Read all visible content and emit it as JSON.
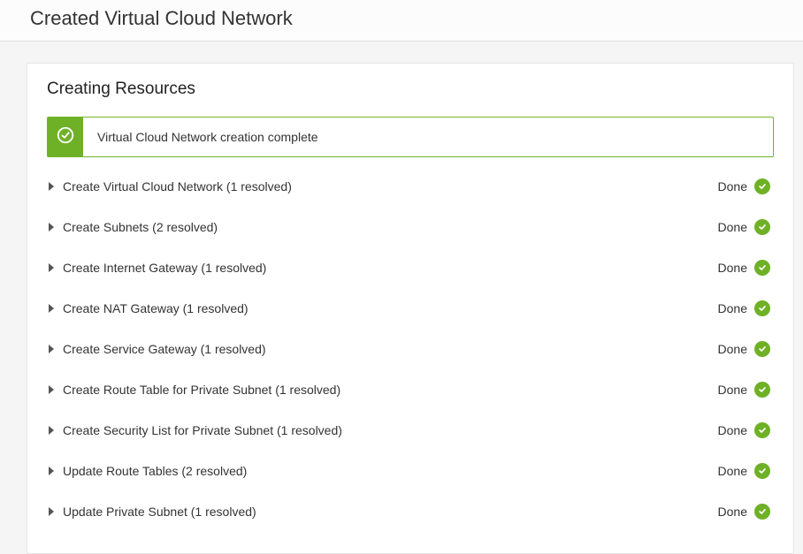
{
  "header": {
    "title": "Created Virtual Cloud Network"
  },
  "panel": {
    "title": "Creating Resources",
    "banner_message": "Virtual Cloud Network creation complete",
    "done_label": "Done",
    "steps": [
      {
        "label": "Create Virtual Cloud Network (1 resolved)",
        "status": "Done"
      },
      {
        "label": "Create Subnets (2 resolved)",
        "status": "Done"
      },
      {
        "label": "Create Internet Gateway (1 resolved)",
        "status": "Done"
      },
      {
        "label": "Create NAT Gateway (1 resolved)",
        "status": "Done"
      },
      {
        "label": "Create Service Gateway (1 resolved)",
        "status": "Done"
      },
      {
        "label": "Create Route Table for Private Subnet (1 resolved)",
        "status": "Done"
      },
      {
        "label": "Create Security List for Private Subnet (1 resolved)",
        "status": "Done"
      },
      {
        "label": "Update Route Tables (2 resolved)",
        "status": "Done"
      },
      {
        "label": "Update Private Subnet (1 resolved)",
        "status": "Done"
      }
    ]
  }
}
